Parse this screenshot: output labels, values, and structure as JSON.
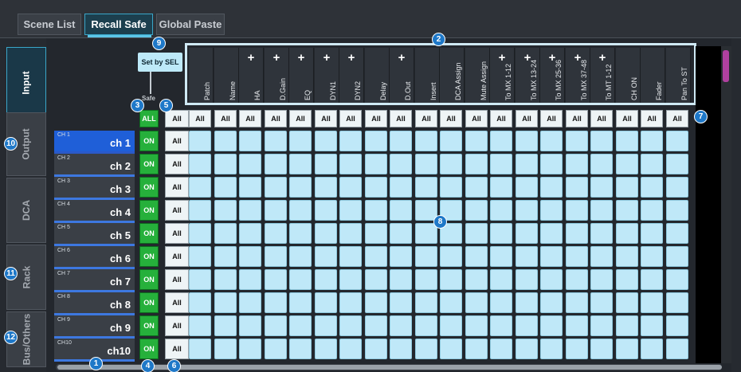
{
  "tabs": [
    "Scene List",
    "Recall Safe",
    "Global Paste"
  ],
  "active_tab": "Recall Safe",
  "side_tabs": [
    "Input",
    "Output",
    "DCA",
    "Rack",
    "Bus/Others"
  ],
  "active_side_tab": "Input",
  "set_by_sel_label": "Set by SEL",
  "safe_label": "Safe",
  "safe_all_label": "ALL",
  "all_label": "All",
  "on_label": "ON",
  "columns": [
    {
      "label": "Patch",
      "plus": false
    },
    {
      "label": "Name",
      "plus": false
    },
    {
      "label": "HA",
      "plus": true
    },
    {
      "label": "D.Gain",
      "plus": true
    },
    {
      "label": "EQ",
      "plus": true
    },
    {
      "label": "DYN1",
      "plus": true
    },
    {
      "label": "DYN2",
      "plus": true
    },
    {
      "label": "Delay",
      "plus": false
    },
    {
      "label": "D.Out",
      "plus": true
    },
    {
      "label": "Insert",
      "plus": false
    },
    {
      "label": "DCA Assign",
      "plus": false
    },
    {
      "label": "Mute Assign",
      "plus": false
    },
    {
      "label": "To MX 1-12",
      "plus": true
    },
    {
      "label": "To MX 13-24",
      "plus": true
    },
    {
      "label": "To MX 25-36",
      "plus": true
    },
    {
      "label": "To MX 37-48",
      "plus": true
    },
    {
      "label": "To MT 1-12",
      "plus": true
    },
    {
      "label": "CH ON",
      "plus": false
    },
    {
      "label": "Fader",
      "plus": false
    },
    {
      "label": "Pan To ST",
      "plus": false
    }
  ],
  "channels": [
    {
      "num": "CH 1",
      "name": "ch 1"
    },
    {
      "num": "CH 2",
      "name": "ch 2"
    },
    {
      "num": "CH 3",
      "name": "ch 3"
    },
    {
      "num": "CH 4",
      "name": "ch 4"
    },
    {
      "num": "CH 5",
      "name": "ch 5"
    },
    {
      "num": "CH 6",
      "name": "ch 6"
    },
    {
      "num": "CH 7",
      "name": "ch 7"
    },
    {
      "num": "CH 8",
      "name": "ch 8"
    },
    {
      "num": "CH 9",
      "name": "ch 9"
    },
    {
      "num": "CH10",
      "name": "ch10"
    }
  ],
  "selected_channel": "CH 1",
  "callouts": [
    "1",
    "2",
    "3",
    "4",
    "5",
    "6",
    "7",
    "8",
    "9",
    "10",
    "11",
    "12"
  ],
  "colors": {
    "accent": "#5cc6e8",
    "safe_on": "#26b03b",
    "cell": "#bfe8f8",
    "selected_channel": "#1f5fd8",
    "callout": "#1e78c8",
    "scroll_thumb": "#b0409f"
  }
}
